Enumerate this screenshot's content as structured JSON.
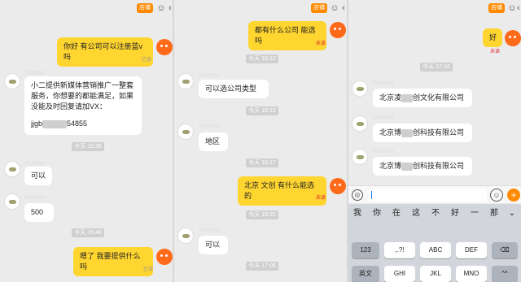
{
  "common": {
    "chat_tag": "店铺",
    "back_glyph": "‹",
    "person_glyph": "☺"
  },
  "p1": {
    "msg1": "你好 有公司可以注册蓝v吗",
    "status1": "已读",
    "msg2_line1": "小二提供新媒体营销推广一整套",
    "msg2_line2": "服务，你想要的都能满足，如果",
    "msg2_line3": "没能及时回复请加VX：",
    "msg2_prefix": "jjgb",
    "msg2_suffix": "54855",
    "time1": "今天 15:38",
    "msg3": "可以",
    "msg4": "500",
    "time2": "今天 15:40",
    "msg5": "嗯了 我要提供什么吗",
    "status2": "已读"
  },
  "p2": {
    "msg1": "都有什么公司 能选吗",
    "status1": "未读",
    "time1": "今天 16:12",
    "msg2": "可以选公司类型",
    "time2": "今天 16:12",
    "msg3": "地区",
    "time3": "今天 16:17",
    "msg4": "北京 文创 有什么能选的",
    "status2": "未读",
    "time4": "今天 16:22",
    "msg5": "可以",
    "time5": "今天 17:05"
  },
  "p3": {
    "msg1": "好",
    "status1": "未读",
    "time1": "今天 17:16",
    "co1_a": "北京凌",
    "co1_b": "创文化有限公司",
    "co2_a": "北京博",
    "co2_b": "创科技有限公司",
    "co3_a": "北京博",
    "co3_b": "创科技有限公司",
    "voice_glyph": "◎",
    "emoji_glyph": "☺",
    "plus_glyph": "+",
    "candidates": [
      "我",
      "你",
      "在",
      "这",
      "不",
      "好",
      "一",
      "那",
      "⌄"
    ],
    "keys_row1": [
      "123",
      ",.?!",
      "ABC",
      "DEF",
      "⌫"
    ],
    "keys_row2": [
      "英文",
      "GHI",
      "JKL",
      "MNO",
      "^^"
    ]
  }
}
